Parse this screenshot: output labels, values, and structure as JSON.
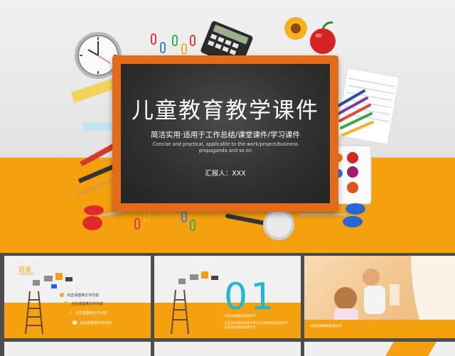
{
  "hero": {
    "title": "儿童教育教学课件",
    "subtitle": "简洁实用·适用于工作总结/课堂课件/学习课件",
    "english": "Concise and practical, applicable to the work/project/business propaganda and so on",
    "reporter": "汇报人：XXX"
  },
  "thumb_toc": {
    "title": "目录",
    "subtitle": "CONTENTS",
    "items": [
      "点击请替换文字内容",
      "点击请替换文字内容",
      "点击请替换文字内容",
      "点击请替换文字内容"
    ]
  },
  "thumb_section": {
    "number": "01",
    "heading": "点击添加相关标题文字",
    "body": "点击添加相关标题文字点击添加相关标题文字点击添加相关标题文字"
  },
  "thumb_photo": {
    "caption": "点击添加相关标题文字"
  },
  "colors": {
    "accent": "#f5a10f",
    "board_frame": "#e06b1a",
    "number": "#1fb8d2"
  }
}
